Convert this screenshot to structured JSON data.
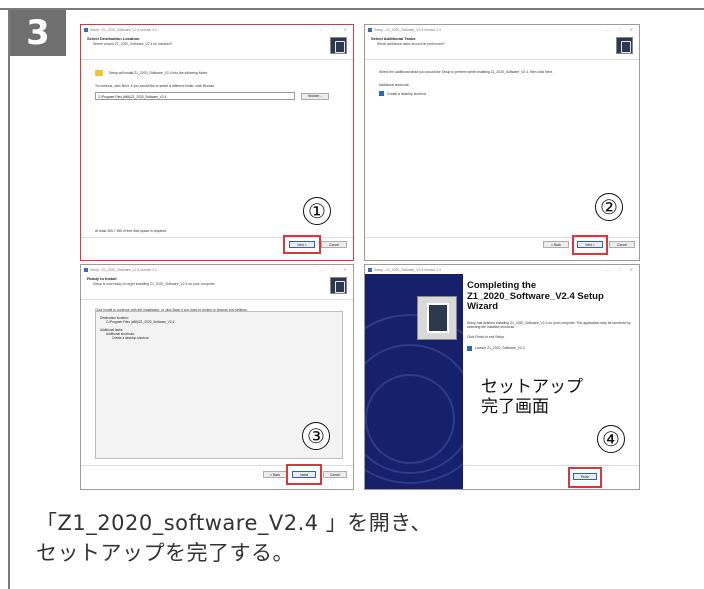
{
  "step_number": "3",
  "caption_lines": [
    "「Z1_2020_software_V2.4 」を開き、",
    "セットアップを完了する。"
  ],
  "screen1": {
    "titlebar": "Setup - Z1_2020_Software_V2.4 version 2.4",
    "title": "Select Destination Location",
    "subtitle": "Where should Z1_2020_Software_V2.4 be installed?",
    "line1": "Setup will install Z1_2020_Software_V2.4 into the following folder.",
    "line2": "To continue, click Next. If you would like to select a different folder, click Browse.",
    "path": "C:\\Program Files (x86)\\Z1_2020_Software_V2.4",
    "browse_label": "Browse...",
    "disk_space": "At least 305.7 MB of free disk space is required.",
    "next_label": "Next >",
    "cancel_label": "Cancel",
    "marker": "①"
  },
  "screen2": {
    "titlebar": "Setup - Z1_2020_Software_V2.4 version 2.4",
    "title": "Select Additional Tasks",
    "subtitle": "Which additional tasks should be performed?",
    "line1": "Select the additional tasks you would like Setup to perform while installing Z1_2020_Software_V2.4, then click Next.",
    "section": "Additional shortcuts:",
    "checkbox_label": "Create a desktop shortcut",
    "back_label": "< Back",
    "next_label": "Next >",
    "cancel_label": "Cancel",
    "marker": "②"
  },
  "screen3": {
    "titlebar": "Setup - Z1_2020_Software_V2.4 version 2.4",
    "title": "Ready to Install",
    "subtitle": "Setup is now ready to begin installing Z1_2020_Software_V2.4 on your computer.",
    "line1": "Click Install to continue with the installation, or click Back if you want to review or change any settings.",
    "summary": [
      "Destination location:",
      "    C:\\Program Files (x86)\\Z1_2020_Software_V2.4",
      "",
      "Additional tasks:",
      "    Additional shortcuts:",
      "        Create a desktop shortcut"
    ],
    "back_label": "< Back",
    "install_label": "Install",
    "cancel_label": "Cancel",
    "marker": "③"
  },
  "screen4": {
    "titlebar": "Setup - Z1_2020_Software_V2.4 version 2.4",
    "title": "Completing the Z1_2020_Software_V2.4 Setup Wizard",
    "line1": "Setup has finished installing Z1_2020_Software_V2.4 on your computer. The application may be launched by selecting the installed shortcuts.",
    "line2": "Click Finish to exit Setup.",
    "checkbox_label": "Launch Z1_2020_Software_V2.4",
    "overlay_line1": "セットアップ",
    "overlay_line2": "完了画面",
    "finish_label": "Finish",
    "marker": "④"
  }
}
